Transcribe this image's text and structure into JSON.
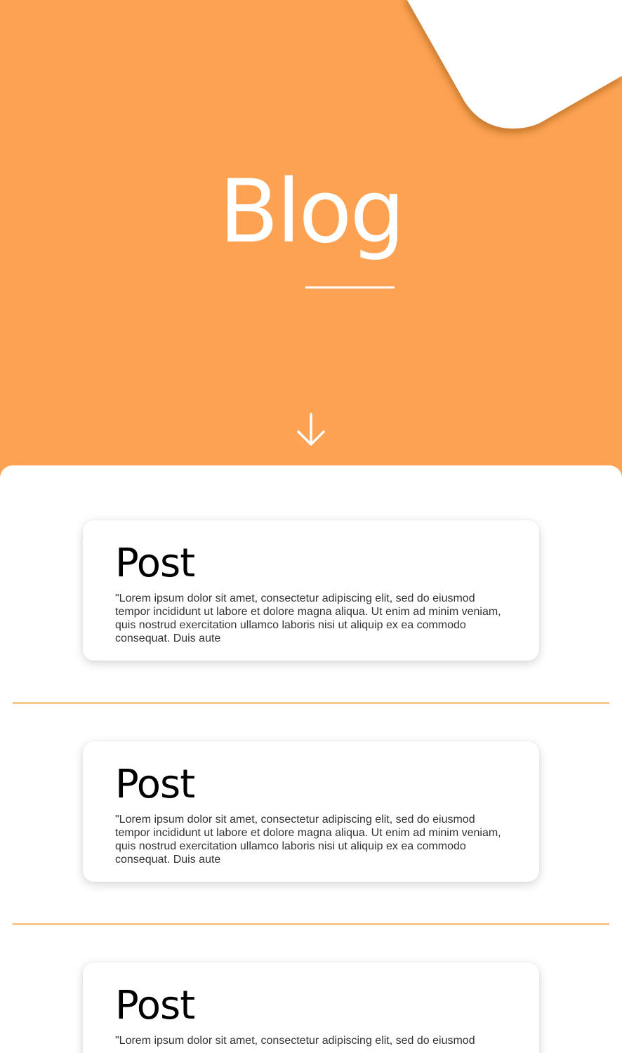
{
  "hero": {
    "title": "Blog",
    "scroll_icon": "arrow-down-icon",
    "background_color": "#fda253",
    "text_color": "#ffffff"
  },
  "posts": [
    {
      "title": "Post",
      "excerpt": "\"Lorem ipsum dolor sit amet, consectetur adipiscing elit, sed do eiusmod tempor incididunt ut labore et dolore magna aliqua. Ut enim ad minim veniam, quis nostrud exercitation ullamco laboris nisi ut aliquip ex ea commodo consequat. Duis aute"
    },
    {
      "title": "Post",
      "excerpt": "\"Lorem ipsum dolor sit amet, consectetur adipiscing elit, sed do eiusmod tempor incididunt ut labore et dolore magna aliqua. Ut enim ad minim veniam, quis nostrud exercitation ullamco laboris nisi ut aliquip ex ea commodo consequat. Duis aute"
    },
    {
      "title": "Post",
      "excerpt": "\"Lorem ipsum dolor sit amet, consectetur adipiscing elit, sed do eiusmod"
    }
  ],
  "colors": {
    "accent": "#fda253",
    "divider": "#f6ca8c",
    "card_background": "#ffffff"
  }
}
